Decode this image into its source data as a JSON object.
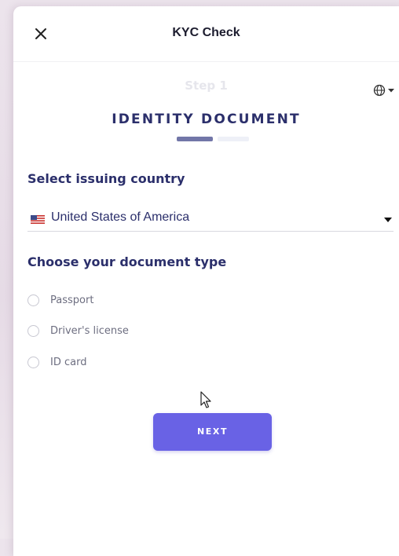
{
  "header": {
    "title": "KYC Check",
    "close_icon": "close-icon"
  },
  "language": {
    "icon": "globe-icon",
    "caret_icon": "chevron-down-icon"
  },
  "step": {
    "label": "Step 1",
    "title": "IDENTITY DOCUMENT",
    "progress": {
      "current": 1,
      "total": 2
    }
  },
  "country": {
    "section_title": "Select issuing country",
    "selected_value": "United States of America",
    "flag_icon": "us-flag-icon"
  },
  "document": {
    "section_title": "Choose your document type",
    "options": [
      {
        "label": "Passport",
        "selected": false
      },
      {
        "label": "Driver's license",
        "selected": false
      },
      {
        "label": "ID card",
        "selected": false
      }
    ]
  },
  "actions": {
    "next_label": "NEXT"
  },
  "colors": {
    "accent": "#6962e5",
    "heading": "#2b2f6b",
    "progress_active": "#7276a8",
    "progress_inactive": "#eef0f7",
    "step_muted": "#e6e6ec"
  }
}
